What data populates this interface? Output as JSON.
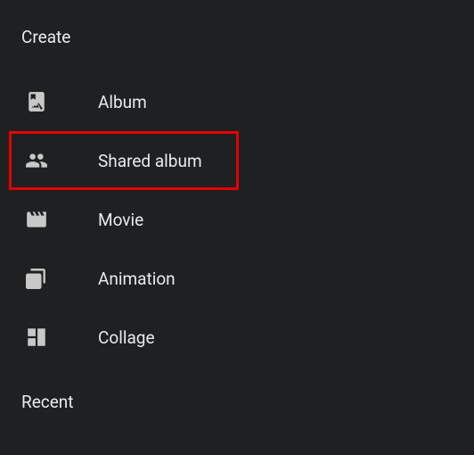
{
  "section": {
    "title": "Create"
  },
  "menu": {
    "items": [
      {
        "id": "album",
        "label": "Album",
        "highlighted": false
      },
      {
        "id": "shared-album",
        "label": "Shared album",
        "highlighted": true
      },
      {
        "id": "movie",
        "label": "Movie",
        "highlighted": false
      },
      {
        "id": "animation",
        "label": "Animation",
        "highlighted": false
      },
      {
        "id": "collage",
        "label": "Collage",
        "highlighted": false
      }
    ]
  },
  "recent": {
    "title": "Recent"
  }
}
